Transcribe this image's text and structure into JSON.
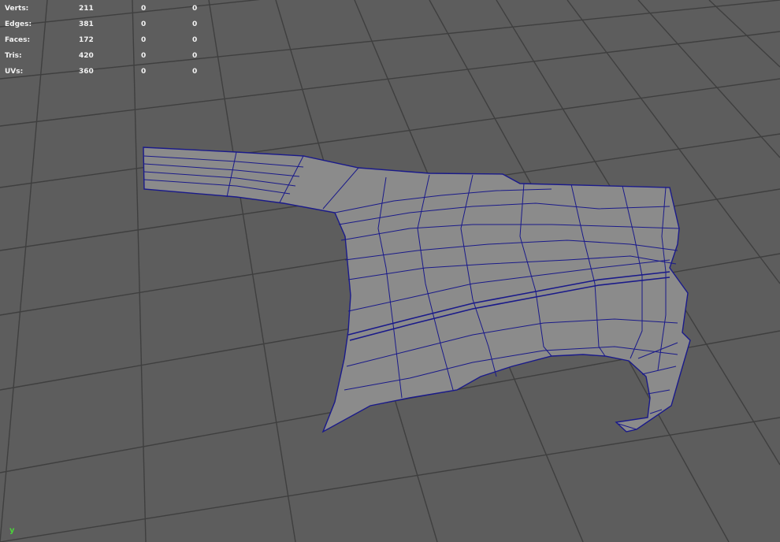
{
  "viewport": {
    "name": "perspective-viewport",
    "background": "#5d5d5d",
    "grid_color": "#3e3e3e",
    "wireframe_color": "#1a1a8a",
    "mesh_fill": "#8c8c8c"
  },
  "hud": {
    "rows": [
      {
        "label": "Verts:",
        "total": "211",
        "selected": "0",
        "uv": "0"
      },
      {
        "label": "Edges:",
        "total": "381",
        "selected": "0",
        "uv": "0"
      },
      {
        "label": "Faces:",
        "total": "172",
        "selected": "0",
        "uv": "0"
      },
      {
        "label": "Tris:",
        "total": "420",
        "selected": "0",
        "uv": "0"
      },
      {
        "label": "UVs:",
        "total": "360",
        "selected": "0",
        "uv": "0"
      }
    ]
  },
  "axis_gizmo": {
    "label": "y",
    "color": "#4bd33a"
  }
}
